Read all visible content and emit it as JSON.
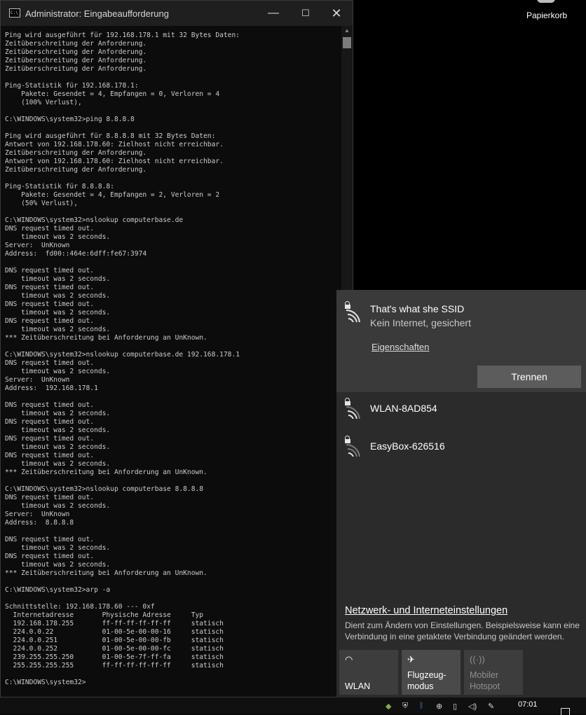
{
  "desktop": {
    "recycle_bin_label": "Papierkorb"
  },
  "cmd_window": {
    "title": "Administrator: Eingabeaufforderung",
    "icon_text": "C:\\_",
    "minimize_glyph": "—",
    "maximize_glyph": "☐",
    "close_glyph": "✕",
    "console_text": "Ping wird ausgeführt für 192.168.178.1 mit 32 Bytes Daten:\nZeitüberschreitung der Anforderung.\nZeitüberschreitung der Anforderung.\nZeitüberschreitung der Anforderung.\nZeitüberschreitung der Anforderung.\n\nPing-Statistik für 192.168.178.1:\n    Pakete: Gesendet = 4, Empfangen = 0, Verloren = 4\n    (100% Verlust),\n\nC:\\WINDOWS\\system32>ping 8.8.8.8\n\nPing wird ausgeführt für 8.8.8.8 mit 32 Bytes Daten:\nAntwort von 192.168.178.60: Zielhost nicht erreichbar.\nZeitüberschreitung der Anforderung.\nAntwort von 192.168.178.60: Zielhost nicht erreichbar.\nZeitüberschreitung der Anforderung.\n\nPing-Statistik für 8.8.8.8:\n    Pakete: Gesendet = 4, Empfangen = 2, Verloren = 2\n    (50% Verlust),\n\nC:\\WINDOWS\\system32>nslookup computerbase.de\nDNS request timed out.\n    timeout was 2 seconds.\nServer:  UnKnown\nAddress:  fd00::464e:6dff:fe67:3974\n\nDNS request timed out.\n    timeout was 2 seconds.\nDNS request timed out.\n    timeout was 2 seconds.\nDNS request timed out.\n    timeout was 2 seconds.\nDNS request timed out.\n    timeout was 2 seconds.\n*** Zeitüberschreitung bei Anforderung an UnKnown.\n\nC:\\WINDOWS\\system32>nslookup computerbase.de 192.168.178.1\nDNS request timed out.\n    timeout was 2 seconds.\nServer:  UnKnown\nAddress:  192.168.178.1\n\nDNS request timed out.\n    timeout was 2 seconds.\nDNS request timed out.\n    timeout was 2 seconds.\nDNS request timed out.\n    timeout was 2 seconds.\nDNS request timed out.\n    timeout was 2 seconds.\n*** Zeitüberschreitung bei Anforderung an UnKnown.\n\nC:\\WINDOWS\\system32>nslookup computerbase 8.8.8.8\nDNS request timed out.\n    timeout was 2 seconds.\nServer:  UnKnown\nAddress:  8.8.8.8\n\nDNS request timed out.\n    timeout was 2 seconds.\nDNS request timed out.\n    timeout was 2 seconds.\n*** Zeitüberschreitung bei Anforderung an UnKnown.\n\nC:\\WINDOWS\\system32>arp -a\n\nSchnittstelle: 192.168.178.60 --- 0xf\n  Internetadresse       Physische Adresse     Typ\n  192.168.178.255       ff-ff-ff-ff-ff-ff     statisch\n  224.0.0.22            01-00-5e-00-00-16     statisch\n  224.0.0.251           01-00-5e-00-00-fb     statisch\n  224.0.0.252           01-00-5e-00-00-fc     statisch\n  239.255.255.250       01-00-5e-7f-ff-fa     statisch\n  255.255.255.255       ff-ff-ff-ff-ff-ff     statisch\n\nC:\\WINDOWS\\system32>"
  },
  "network_flyout": {
    "connected": {
      "ssid": "That's what she SSID",
      "status": "Kein Internet, gesichert",
      "properties_link": "Eigenschaften",
      "disconnect_button": "Trennen"
    },
    "networks": [
      {
        "ssid": "WLAN-8AD854"
      },
      {
        "ssid": "EasyBox-626516"
      }
    ],
    "settings_link": "Netzwerk- und Interneteinstellungen",
    "settings_description": "Dient zum Ändern von Einstellungen. Beispielsweise kann eine Verbindung in eine getaktete Verbindung geändert werden.",
    "quick_actions": [
      {
        "label": "WLAN",
        "icon": "wifi-icon"
      },
      {
        "label": "Flugzeug-\nmodus",
        "icon": "airplane-icon"
      },
      {
        "label": "Mobiler\nHotspot",
        "icon": "hotspot-icon"
      }
    ]
  },
  "taskbar": {
    "time": "07:01"
  },
  "colors": {
    "console_bg": "#0c0c0c",
    "console_text": "#cccccc",
    "flyout_bg": "#2b2b2b",
    "active_network_bg": "#3a3a3a",
    "disconnect_button_bg": "#5c5c5c"
  }
}
